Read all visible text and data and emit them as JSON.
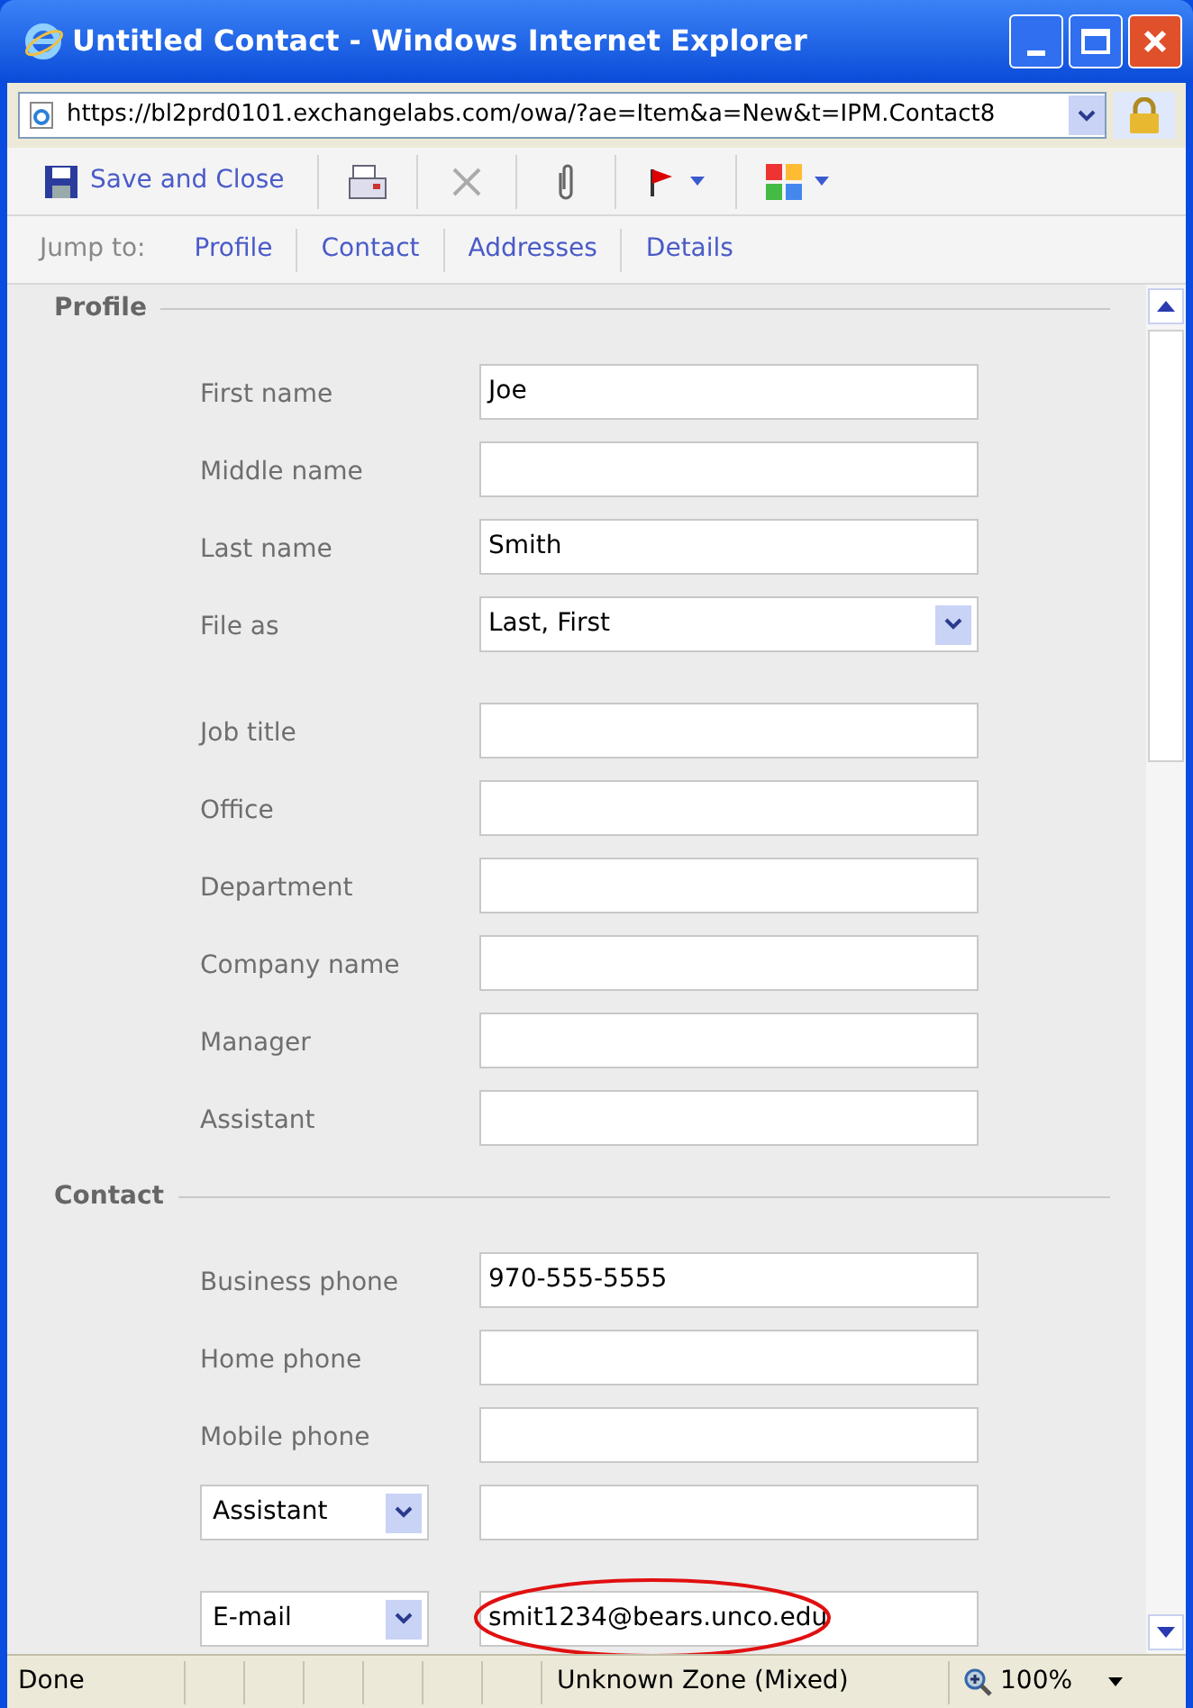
{
  "window": {
    "title": "Untitled Contact - Windows Internet Explorer"
  },
  "address_bar": {
    "url": "https://bl2prd0101.exchangelabs.com/owa/?ae=Item&a=New&t=IPM.Contact8"
  },
  "toolbar": {
    "save_label": "Save and Close"
  },
  "jump_bar": {
    "label": "Jump to:",
    "links": [
      "Profile",
      "Contact",
      "Addresses",
      "Details"
    ]
  },
  "sections": [
    {
      "title": "Profile",
      "groups": [
        [
          {
            "kind": "text",
            "label": "First name",
            "value": "Joe"
          },
          {
            "kind": "text",
            "label": "Middle name"
          },
          {
            "kind": "text",
            "label": "Last name",
            "value": "Smith"
          },
          {
            "kind": "select",
            "label": "File as",
            "value": "Last, First"
          }
        ],
        [
          {
            "kind": "text",
            "label": "Job title"
          },
          {
            "kind": "text",
            "label": "Office"
          },
          {
            "kind": "text",
            "label": "Department"
          },
          {
            "kind": "text",
            "label": "Company name"
          },
          {
            "kind": "text",
            "label": "Manager"
          },
          {
            "kind": "text",
            "label": "Assistant"
          }
        ]
      ]
    },
    {
      "title": "Contact",
      "groups": [
        [
          {
            "kind": "text",
            "label": "Business phone",
            "value": "970-555-5555"
          },
          {
            "kind": "text",
            "label": "Home phone"
          },
          {
            "kind": "text",
            "label": "Mobile phone"
          },
          {
            "kind": "chooser",
            "selector": "Assistant"
          }
        ],
        [
          {
            "kind": "chooser",
            "selector": "E-mail",
            "value": "smit1234@bears.unco.edu",
            "circled": true
          }
        ]
      ]
    }
  ],
  "status_bar": {
    "status": "Done",
    "zone": "Unknown Zone (Mixed)",
    "zoom": "100%"
  }
}
